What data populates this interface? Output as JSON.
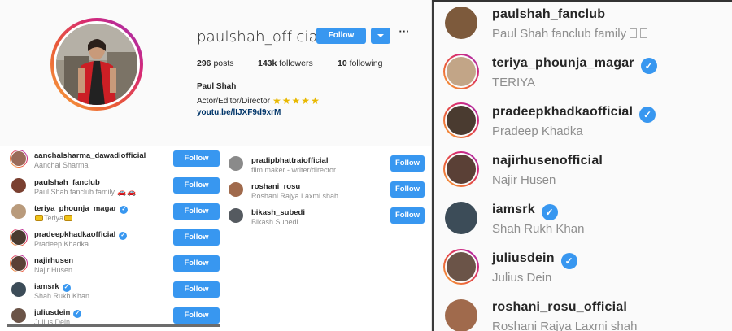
{
  "profile": {
    "username": "paulshah_official",
    "follow_label": "Follow",
    "more_label": "···",
    "stats": {
      "posts": "296",
      "posts_label": "posts",
      "followers": "143k",
      "followers_label": "followers",
      "following": "10",
      "following_label": "following"
    },
    "full_name": "Paul Shah",
    "bio": "Actor/Editor/Director",
    "stars": "★★★★★",
    "link": "youtu.be/lIJXF9d9xrM"
  },
  "list_a": {
    "items": [
      {
        "username": "aanchalsharma_dawadiofficial",
        "subtitle": "Aanchal Sharma",
        "verified": false,
        "button": "Follow",
        "color": "#9a6b5a"
      },
      {
        "username": "paulshah_fanclub",
        "subtitle": "Paul Shah fanclub family",
        "verified": false,
        "button": "Follow",
        "color": "#7a4030"
      },
      {
        "username": "teriya_phounja_magar",
        "subtitle": "Teriya",
        "verified": true,
        "button": "Follow",
        "color": "#b99b7c"
      },
      {
        "username": "pradeepkhadkaofficial",
        "subtitle": "Pradeep Khadka",
        "verified": true,
        "button": "Follow",
        "color": "#4a3b30"
      },
      {
        "username": "najirhusen__",
        "subtitle": "Najir Husen",
        "verified": false,
        "button": "Follow",
        "color": "#5a4036"
      },
      {
        "username": "iamsrk",
        "subtitle": "Shah Rukh Khan",
        "verified": true,
        "button": "Follow",
        "color": "#3c4c58"
      },
      {
        "username": "juliusdein",
        "subtitle": "Julius Dein",
        "verified": true,
        "button": "Follow",
        "color": "#6b5448"
      }
    ]
  },
  "list_b": {
    "items": [
      {
        "username": "pradipbhattraiofficial",
        "subtitle": "film maker - writer/director",
        "button": "Follow",
        "color": "#8a8a8a"
      },
      {
        "username": "roshani_rosu",
        "subtitle": "Roshani Rajya Laxmi shah",
        "button": "Follow",
        "color": "#a06a4c"
      },
      {
        "username": "bikash_subedi",
        "subtitle": "Bikash Subedi",
        "button": "Follow",
        "color": "#555a60"
      }
    ]
  },
  "list_c": {
    "items": [
      {
        "username": "paulshah_fanclub",
        "subtitle": "Paul Shah fanclub family",
        "verified": false,
        "story": false,
        "color": "#7d5a3c"
      },
      {
        "username": "teriya_phounja_magar",
        "subtitle": "TERIYA",
        "verified": true,
        "story": true,
        "color": "#c2a587"
      },
      {
        "username": "pradeepkhadkaofficial",
        "subtitle": "Pradeep Khadka",
        "verified": true,
        "story": true,
        "color": "#4a3b30"
      },
      {
        "username": "najirhusenofficial",
        "subtitle": "Najir Husen",
        "verified": false,
        "story": true,
        "color": "#5a4036"
      },
      {
        "username": "iamsrk",
        "subtitle": "Shah Rukh Khan",
        "verified": true,
        "story": false,
        "color": "#3c4c58"
      },
      {
        "username": "juliusdein",
        "subtitle": "Julius Dein",
        "verified": true,
        "story": true,
        "color": "#6b5448"
      },
      {
        "username": "roshani_rosu_official",
        "subtitle": "Roshani Rajya Laxmi shah",
        "verified": false,
        "story": false,
        "color": "#a06a4c"
      }
    ]
  },
  "colors": {
    "accent": "#3897f0",
    "link": "#003569",
    "muted": "#8e8e8e"
  }
}
